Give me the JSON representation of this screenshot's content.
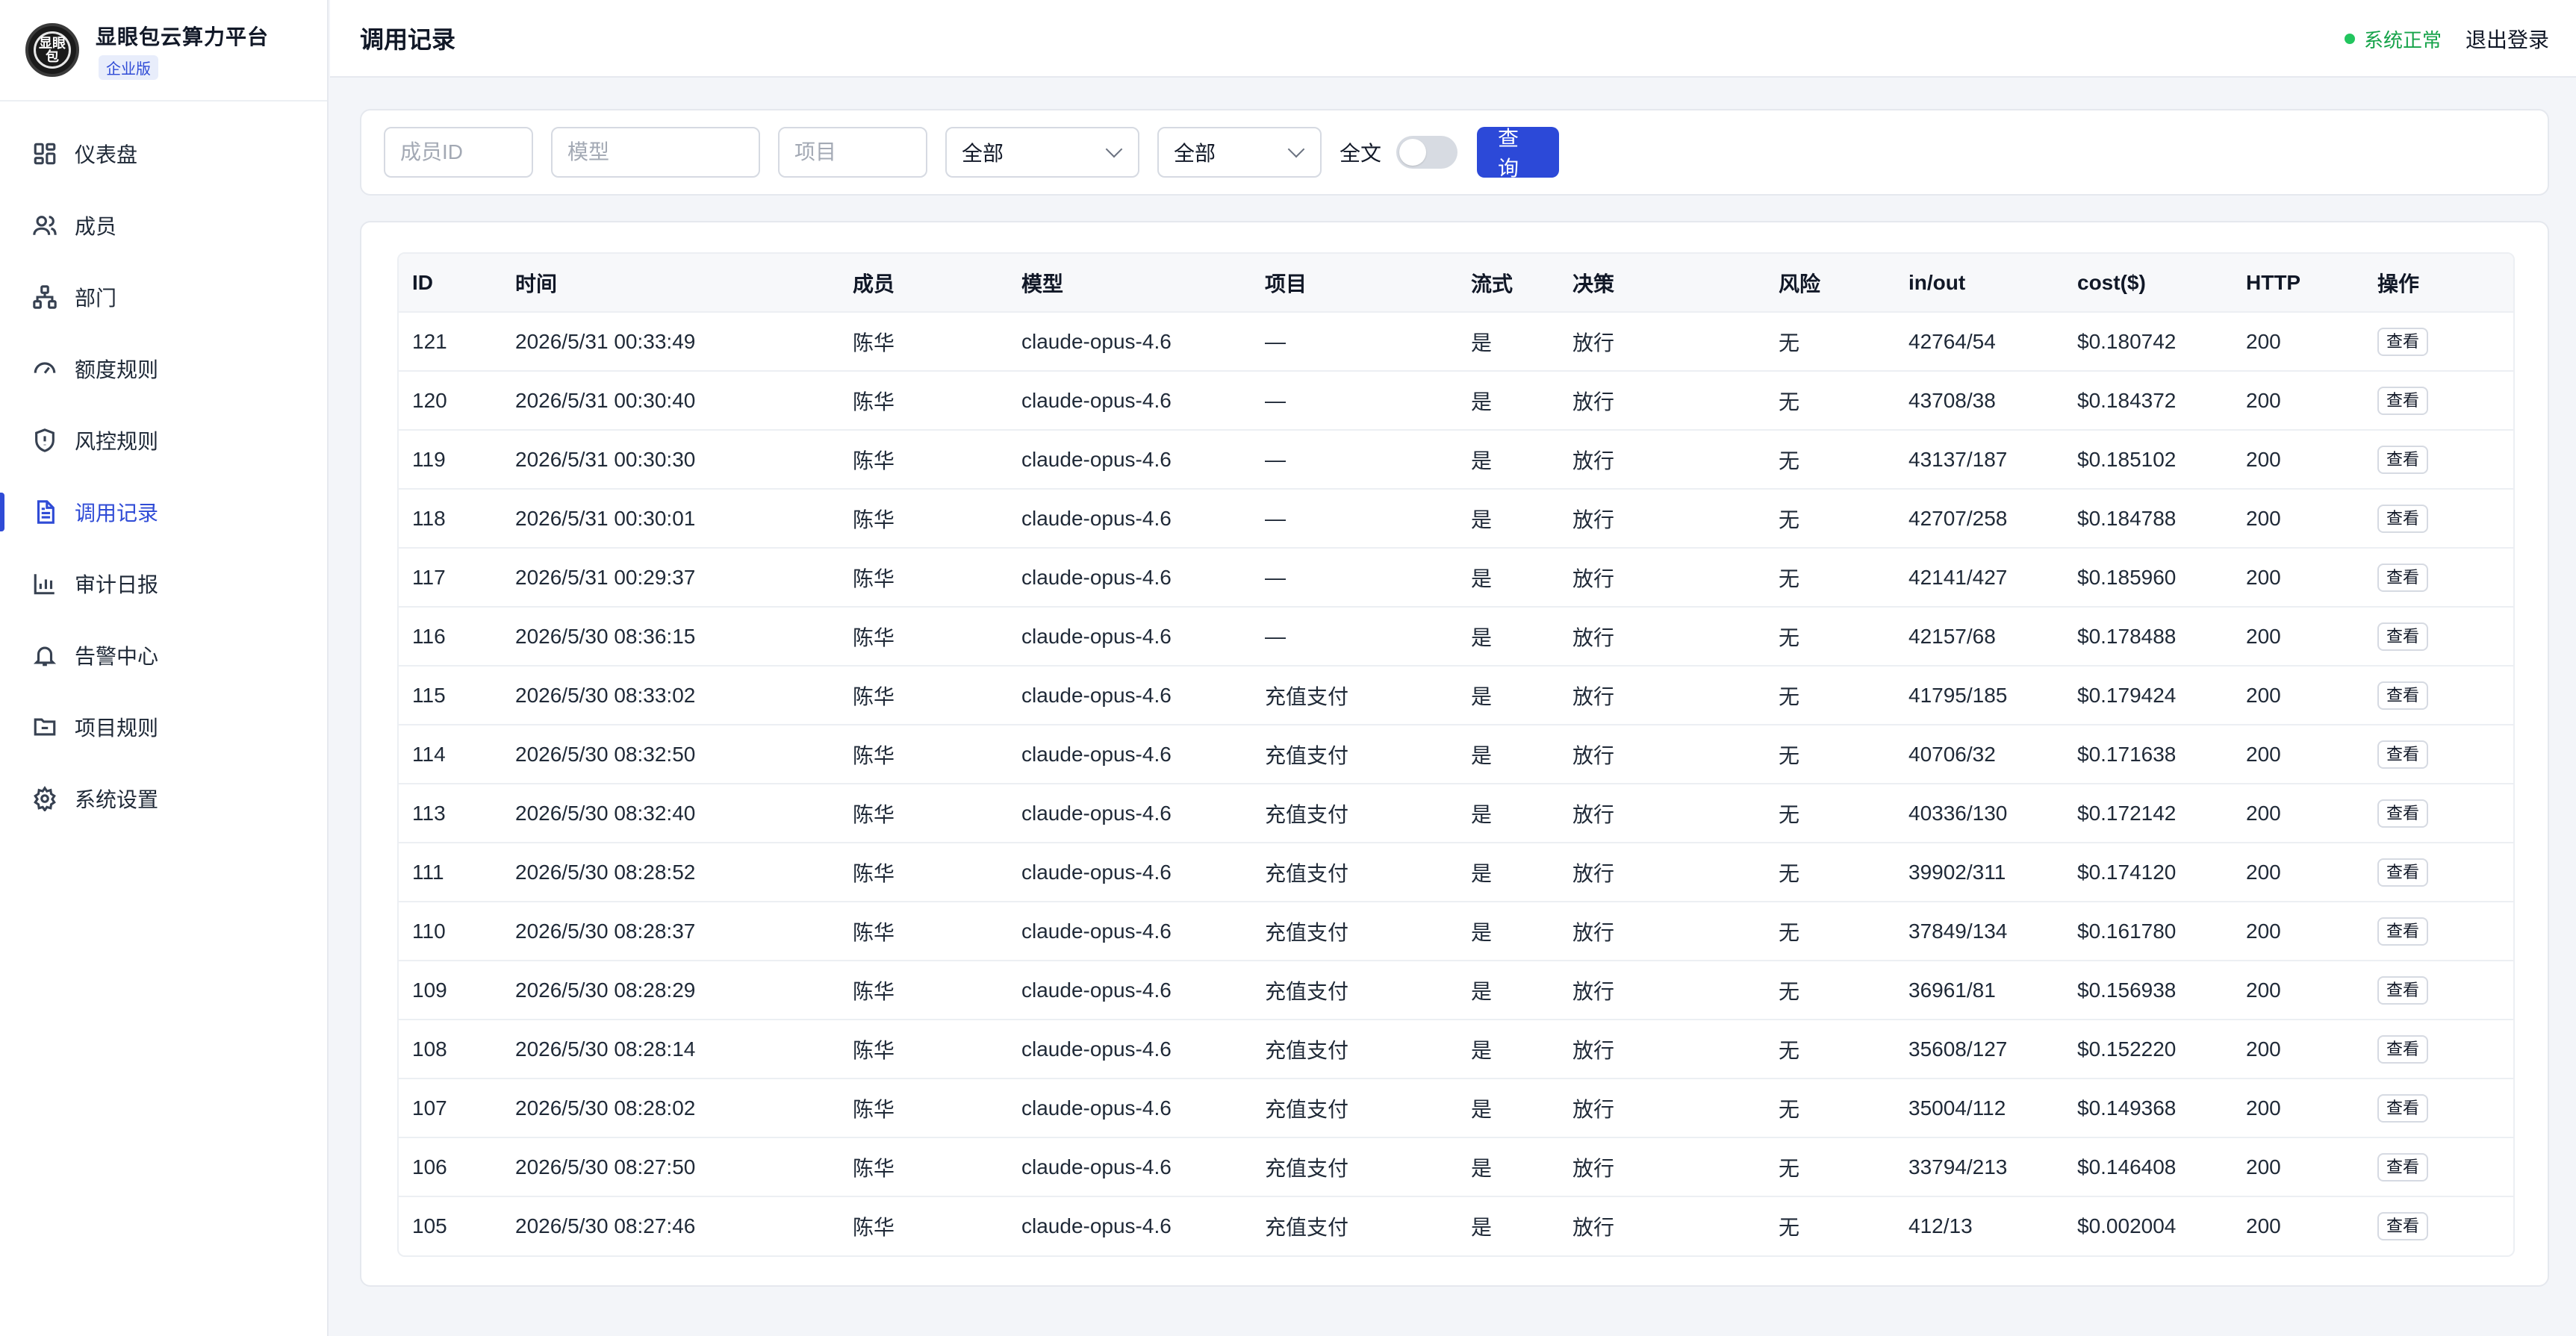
{
  "brand": {
    "name": "显眼包云算力平台",
    "badge": "企业版",
    "logo_text": "显眼包"
  },
  "sidebar": {
    "items": [
      {
        "label": "仪表盘",
        "icon": "dashboard-icon"
      },
      {
        "label": "成员",
        "icon": "users-icon"
      },
      {
        "label": "部门",
        "icon": "org-chart-icon"
      },
      {
        "label": "额度规则",
        "icon": "gauge-icon"
      },
      {
        "label": "风控规则",
        "icon": "shield-icon"
      },
      {
        "label": "调用记录",
        "icon": "document-icon",
        "active": true
      },
      {
        "label": "审计日报",
        "icon": "bar-chart-icon"
      },
      {
        "label": "告警中心",
        "icon": "bell-icon"
      },
      {
        "label": "项目规则",
        "icon": "folder-icon"
      },
      {
        "label": "系统设置",
        "icon": "gear-icon"
      }
    ]
  },
  "header": {
    "title": "调用记录",
    "status": "系统正常",
    "logout": "退出登录",
    "status_color": "#16a34a"
  },
  "filters": {
    "member_placeholder": "成员ID",
    "model_placeholder": "模型",
    "project_placeholder": "项目",
    "select1_value": "全部",
    "select2_value": "全部",
    "fulltext_label": "全文",
    "fulltext_on": false,
    "query_label": "查询"
  },
  "table": {
    "headers": [
      "ID",
      "时间",
      "成员",
      "模型",
      "项目",
      "流式",
      "决策",
      "风险",
      "in/out",
      "cost($)",
      "HTTP",
      "操作"
    ],
    "action_label": "查看",
    "rows": [
      [
        "121",
        "2026/5/31 00:33:49",
        "陈华",
        "claude-opus-4.6",
        "—",
        "是",
        "放行",
        "无",
        "42764/54",
        "$0.180742",
        "200"
      ],
      [
        "120",
        "2026/5/31 00:30:40",
        "陈华",
        "claude-opus-4.6",
        "—",
        "是",
        "放行",
        "无",
        "43708/38",
        "$0.184372",
        "200"
      ],
      [
        "119",
        "2026/5/31 00:30:30",
        "陈华",
        "claude-opus-4.6",
        "—",
        "是",
        "放行",
        "无",
        "43137/187",
        "$0.185102",
        "200"
      ],
      [
        "118",
        "2026/5/31 00:30:01",
        "陈华",
        "claude-opus-4.6",
        "—",
        "是",
        "放行",
        "无",
        "42707/258",
        "$0.184788",
        "200"
      ],
      [
        "117",
        "2026/5/31 00:29:37",
        "陈华",
        "claude-opus-4.6",
        "—",
        "是",
        "放行",
        "无",
        "42141/427",
        "$0.185960",
        "200"
      ],
      [
        "116",
        "2026/5/30 08:36:15",
        "陈华",
        "claude-opus-4.6",
        "—",
        "是",
        "放行",
        "无",
        "42157/68",
        "$0.178488",
        "200"
      ],
      [
        "115",
        "2026/5/30 08:33:02",
        "陈华",
        "claude-opus-4.6",
        "充值支付",
        "是",
        "放行",
        "无",
        "41795/185",
        "$0.179424",
        "200"
      ],
      [
        "114",
        "2026/5/30 08:32:50",
        "陈华",
        "claude-opus-4.6",
        "充值支付",
        "是",
        "放行",
        "无",
        "40706/32",
        "$0.171638",
        "200"
      ],
      [
        "113",
        "2026/5/30 08:32:40",
        "陈华",
        "claude-opus-4.6",
        "充值支付",
        "是",
        "放行",
        "无",
        "40336/130",
        "$0.172142",
        "200"
      ],
      [
        "111",
        "2026/5/30 08:28:52",
        "陈华",
        "claude-opus-4.6",
        "充值支付",
        "是",
        "放行",
        "无",
        "39902/311",
        "$0.174120",
        "200"
      ],
      [
        "110",
        "2026/5/30 08:28:37",
        "陈华",
        "claude-opus-4.6",
        "充值支付",
        "是",
        "放行",
        "无",
        "37849/134",
        "$0.161780",
        "200"
      ],
      [
        "109",
        "2026/5/30 08:28:29",
        "陈华",
        "claude-opus-4.6",
        "充值支付",
        "是",
        "放行",
        "无",
        "36961/81",
        "$0.156938",
        "200"
      ],
      [
        "108",
        "2026/5/30 08:28:14",
        "陈华",
        "claude-opus-4.6",
        "充值支付",
        "是",
        "放行",
        "无",
        "35608/127",
        "$0.152220",
        "200"
      ],
      [
        "107",
        "2026/5/30 08:28:02",
        "陈华",
        "claude-opus-4.6",
        "充值支付",
        "是",
        "放行",
        "无",
        "35004/112",
        "$0.149368",
        "200"
      ],
      [
        "106",
        "2026/5/30 08:27:50",
        "陈华",
        "claude-opus-4.6",
        "充值支付",
        "是",
        "放行",
        "无",
        "33794/213",
        "$0.146408",
        "200"
      ],
      [
        "105",
        "2026/5/30 08:27:46",
        "陈华",
        "claude-opus-4.6",
        "充值支付",
        "是",
        "放行",
        "无",
        "412/13",
        "$0.002004",
        "200"
      ]
    ]
  },
  "colors": {
    "accent": "#2c49d8",
    "status_green": "#16a34a"
  }
}
